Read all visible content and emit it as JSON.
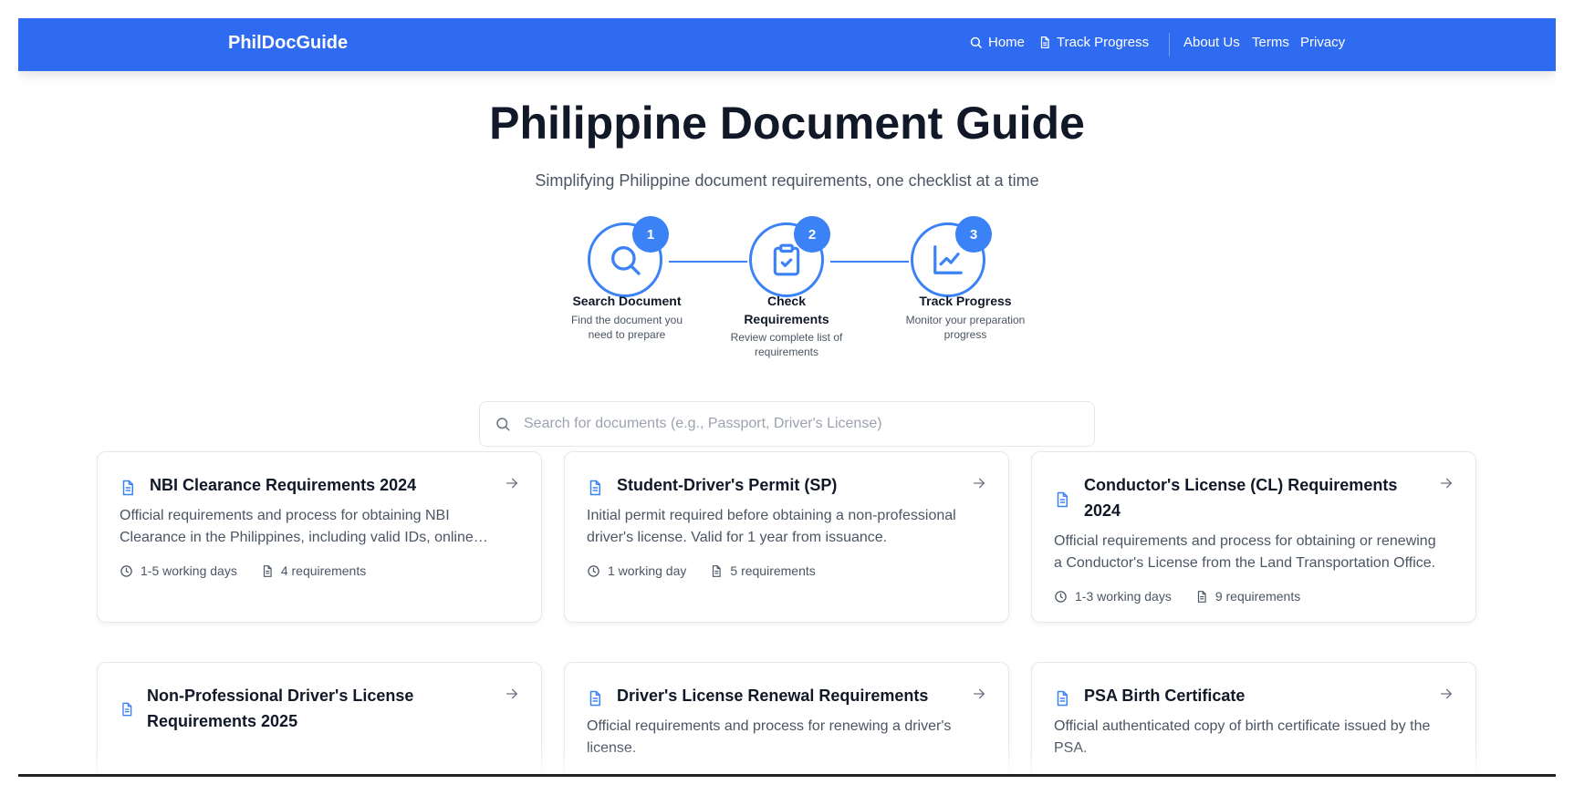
{
  "nav": {
    "brand": "PhilDocGuide",
    "home": "Home",
    "track": "Track Progress",
    "about": "About Us",
    "terms": "Terms",
    "privacy": "Privacy"
  },
  "hero": {
    "title": "Philippine Document Guide",
    "subtitle": "Simplifying Philippine document requirements, one checklist at a time"
  },
  "steps": [
    {
      "number": "1",
      "title": "Search Document",
      "description": "Find the document you need to prepare",
      "icon": "search-icon"
    },
    {
      "number": "2",
      "title": "Check Requirements",
      "description": "Review complete list of requirements",
      "icon": "clipboard-check-icon"
    },
    {
      "number": "3",
      "title": "Track Progress",
      "description": "Monitor your preparation progress",
      "icon": "chart-line-icon"
    }
  ],
  "search": {
    "placeholder": "Search for documents (e.g., Passport, Driver's License)"
  },
  "cards": [
    {
      "title": "NBI Clearance Requirements 2024",
      "description": "Official requirements and process for obtaining NBI Clearance in the Philippines, including valid IDs, online registration, and fees.",
      "duration": "1-5 working days",
      "requirements": "4 requirements"
    },
    {
      "title": "Student-Driver's Permit (SP)",
      "description": "Initial permit required before obtaining a non-professional driver's license. Valid for 1 year from issuance.",
      "duration": "1 working day",
      "requirements": "5 requirements"
    },
    {
      "title": "Conductor's License (CL) Requirements 2024",
      "description": "Official requirements and process for obtaining or renewing a Conductor's License from the Land Transportation Office.",
      "duration": "1-3 working days",
      "requirements": "9 requirements"
    },
    {
      "title": "Non-Professional Driver's License Requirements 2025",
      "description": "",
      "duration": "",
      "requirements": ""
    },
    {
      "title": "Driver's License Renewal Requirements",
      "description": "Official requirements and process for renewing a driver's license.",
      "duration": "",
      "requirements": ""
    },
    {
      "title": "PSA Birth Certificate",
      "description": "Official authenticated copy of birth certificate issued by the PSA.",
      "duration": "",
      "requirements": ""
    }
  ],
  "colors": {
    "primary": "#2f6bf0",
    "accent": "#3b82f6",
    "text": "#111827",
    "muted": "#4b5563"
  }
}
